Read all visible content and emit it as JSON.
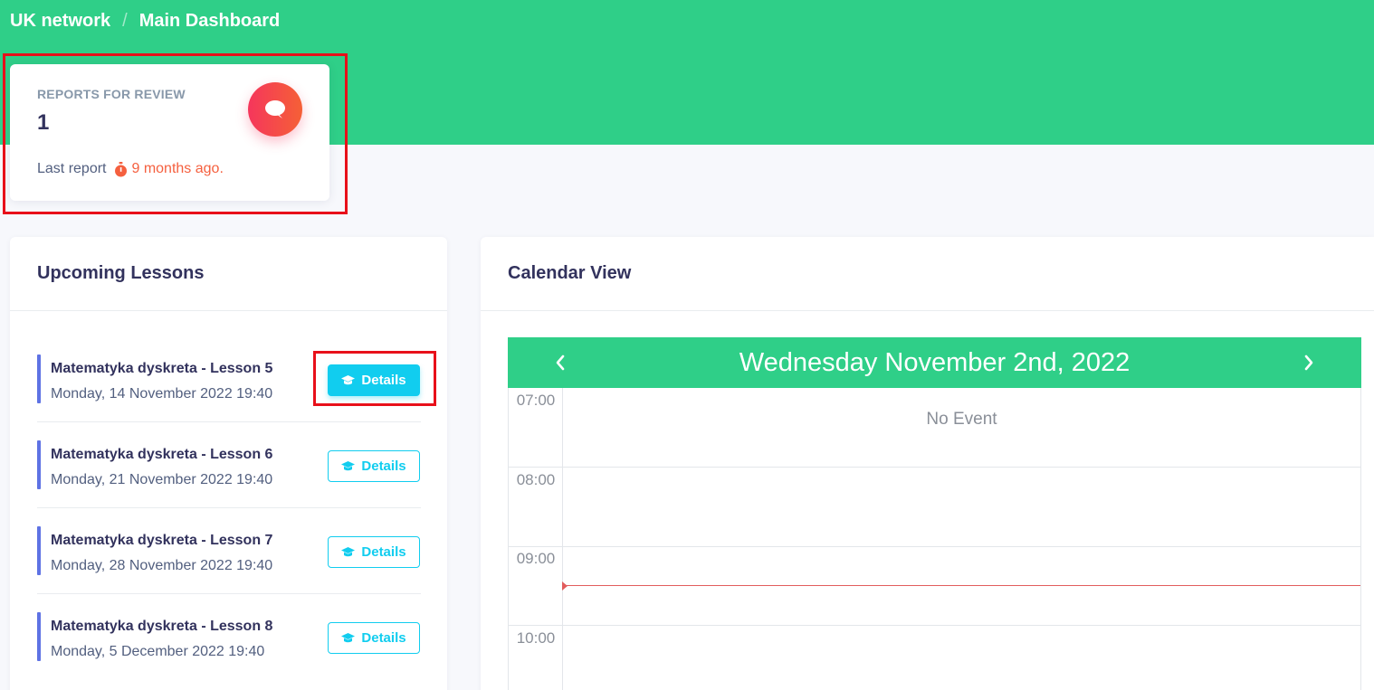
{
  "breadcrumb": {
    "network": "UK network",
    "separator": "/",
    "page": "Main Dashboard"
  },
  "stat_card": {
    "title": "REPORTS FOR REVIEW",
    "value": "1",
    "footer_label": "Last report",
    "footer_since": "9 months ago.",
    "icon": "chat-bubble-icon",
    "icon_color": "#f5365c",
    "since_color": "#f5603f"
  },
  "lessons": {
    "title": "Upcoming Lessons",
    "items": [
      {
        "name": "Matematyka dyskreta - Lesson 5",
        "date": "Monday, 14 November 2022 19:40",
        "button": "Details"
      },
      {
        "name": "Matematyka dyskreta - Lesson 6",
        "date": "Monday, 21 November 2022 19:40",
        "button": "Details"
      },
      {
        "name": "Matematyka dyskreta - Lesson 7",
        "date": "Monday, 28 November 2022 19:40",
        "button": "Details"
      },
      {
        "name": "Matematyka dyskreta - Lesson 8",
        "date": "Monday, 5 December 2022 19:40",
        "button": "Details"
      }
    ]
  },
  "calendar": {
    "title": "Calendar View",
    "date_label": "Wednesday November 2nd, 2022",
    "prev_icon": "chevron-left-icon",
    "next_icon": "chevron-right-icon",
    "times": [
      "07:00",
      "08:00",
      "09:00",
      "10:00"
    ],
    "empty_label": "No Event"
  },
  "colors": {
    "primary_green": "#2fcf88",
    "info": "#11cdef",
    "accent_bar": "#5e72e4",
    "highlight_box": "#e8101a",
    "now_indicator": "#e25d5d"
  }
}
